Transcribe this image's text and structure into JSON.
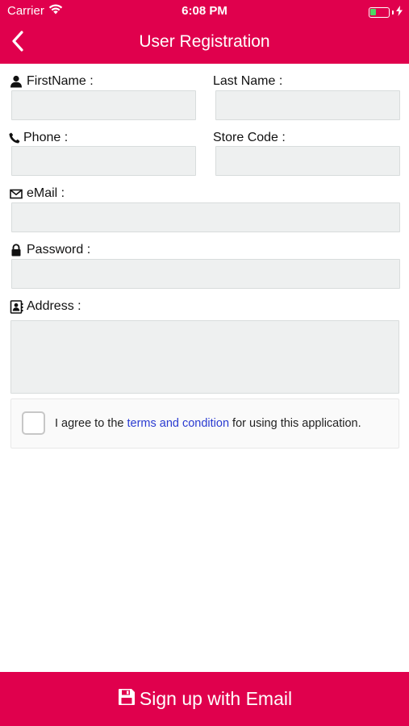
{
  "status_bar": {
    "carrier": "Carrier",
    "time": "6:08 PM",
    "battery_level": 0.35,
    "battery_color": "#4cd964"
  },
  "nav": {
    "title": "User Registration",
    "back_icon": "chevron-left-icon"
  },
  "form": {
    "first_name": {
      "label": "FirstName :",
      "icon": "person-icon",
      "value": ""
    },
    "last_name": {
      "label": "Last Name :",
      "value": ""
    },
    "phone": {
      "label": "Phone :",
      "icon": "phone-icon",
      "value": ""
    },
    "store_code": {
      "label": "Store Code :",
      "value": ""
    },
    "email": {
      "label": "eMail :",
      "icon": "envelope-icon",
      "value": ""
    },
    "password": {
      "label": "Password :",
      "icon": "lock-icon",
      "value": ""
    },
    "address": {
      "label": "Address :",
      "icon": "contact-card-icon",
      "value": ""
    }
  },
  "agreement": {
    "prefix": "I agree to the ",
    "link": "terms and condition",
    "suffix": " for using this application.",
    "checked": false
  },
  "signup_button": {
    "label": "Sign up with Email",
    "icon": "floppy-disk-icon"
  },
  "colors": {
    "accent": "#e0004d",
    "field_bg": "#eef0f0",
    "link": "#2a3bd1"
  }
}
